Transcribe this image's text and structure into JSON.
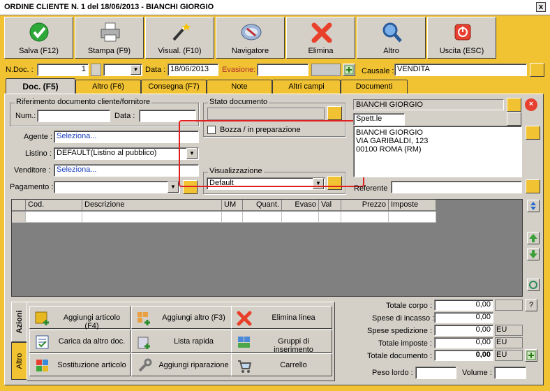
{
  "window": {
    "title": "ORDINE CLIENTE N. 1  del 18/06/2013 - BIANCHI GIORGIO",
    "close": "x"
  },
  "toolbar": [
    {
      "label": "Salva (F12)",
      "icon": "check-icon"
    },
    {
      "label": "Stampa (F9)",
      "icon": "printer-icon"
    },
    {
      "label": "Visual. (F10)",
      "icon": "magic-wand-icon"
    },
    {
      "label": "Navigatore",
      "icon": "compass-icon"
    },
    {
      "label": "Elimina",
      "icon": "delete-icon"
    },
    {
      "label": "Altro",
      "icon": "search-icon"
    },
    {
      "label": "Uscita (ESC)",
      "icon": "exit-icon"
    }
  ],
  "header": {
    "ndoc_label": "N.Doc. :",
    "ndoc_value": "1",
    "series_value": "",
    "data_label": "Data :",
    "data_value": "18/06/2013",
    "evasione_label": "Evasione:",
    "evasione_value": "",
    "causale_label": "Causale :",
    "causale_value": "VENDITA"
  },
  "tabs": [
    "Doc. (F5)",
    "Altro (F6)",
    "Consegna (F7)",
    "Note",
    "Altri campi",
    "Documenti"
  ],
  "riferimento": {
    "title": "Riferimento documento cliente/fornitore",
    "num_label": "Num.:",
    "num_value": "",
    "data_label": "Data :",
    "data_value": ""
  },
  "agente": {
    "label": "Agente :",
    "value": "Seleziona..."
  },
  "listino": {
    "label": "Listino :",
    "value": "DEFAULT(Listino al pubblico)"
  },
  "venditore": {
    "label": "Venditore :",
    "value": "Seleziona..."
  },
  "pagamento": {
    "label": "Pagamento :",
    "value": ""
  },
  "stato": {
    "title": "Stato documento",
    "value": "",
    "bozza_label": "Bozza / in preparazione"
  },
  "visualizzazione": {
    "title": "Visualizzazione",
    "value": "Default"
  },
  "cliente": {
    "name": "BIANCHI GIORGIO",
    "spett": "Spett.le",
    "address_lines": [
      "BIANCHI GIORGIO",
      "VIA GARIBALDI, 123",
      "00100 ROMA (RM)"
    ],
    "referente_label": "Referente",
    "referente_value": ""
  },
  "grid": {
    "columns": [
      "",
      "Cod.",
      "Descrizione",
      "UM",
      "Quant.",
      "Evaso",
      "Val",
      "Prezzo",
      "Imposte"
    ]
  },
  "side_tabs": {
    "azioni": "Azioni",
    "altro": "Altro"
  },
  "actions": [
    {
      "label": "Aggiungi articolo (F4)",
      "icon": "add-article-icon"
    },
    {
      "label": "Aggiungi altro (F3)",
      "icon": "add-other-icon"
    },
    {
      "label": "Elimina linea",
      "icon": "delete-line-icon"
    },
    {
      "label": "Carica da altro doc.",
      "icon": "load-doc-icon"
    },
    {
      "label": "Lista rapida",
      "icon": "quick-list-icon"
    },
    {
      "label": "Gruppi di inserimento",
      "icon": "insert-groups-icon"
    },
    {
      "label": "Sostituzione articolo",
      "icon": "replace-article-icon"
    },
    {
      "label": "Aggiungi riparazione",
      "icon": "repair-icon"
    },
    {
      "label": "Carrello",
      "icon": "cart-icon"
    }
  ],
  "totals": {
    "corpo_label": "Totale corpo :",
    "corpo": "0,00",
    "help": "?",
    "incasso_label": "Spese di incasso :",
    "incasso": "0,00",
    "spedizione_label": "Spese spedizione :",
    "spedizione": "0,00",
    "spedizione_cur": "EU",
    "imposte_label": "Totale imposte :",
    "imposte": "0,00",
    "imposte_cur": "EU",
    "documento_label": "Totale documento :",
    "documento": "0,00",
    "documento_cur": "EU",
    "peso_label": "Peso lordo :",
    "peso": "",
    "volume_label": "Volume :",
    "volume": ""
  },
  "colors": {
    "frame": "#f1c232",
    "panel": "#d4d0c8",
    "highlight": "#e02020",
    "link": "#1a3fc0"
  }
}
